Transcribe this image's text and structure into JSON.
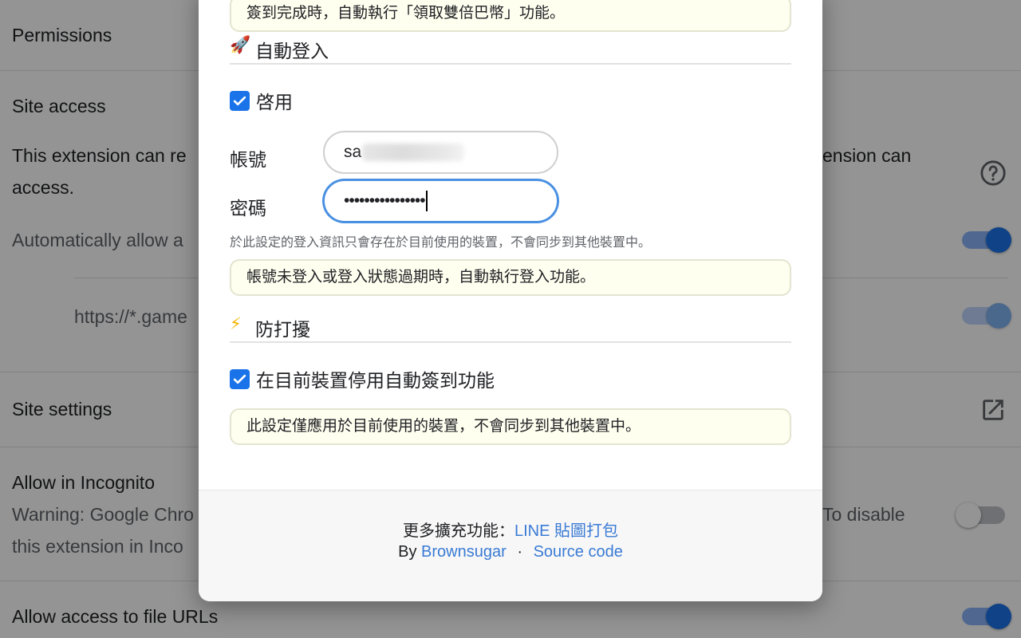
{
  "background": {
    "permissions_title": "Permissions",
    "site_access_title": "Site access",
    "site_access_desc_left": "This extension can re",
    "site_access_desc_right": "ension can",
    "site_access_desc_line2": "access.",
    "auto_allow_text": "Automatically allow a",
    "site_url": "https://*.game",
    "site_settings_title": "Site settings",
    "incognito_title": "Allow in Incognito",
    "incognito_warning_left": "Warning: Google Chro",
    "incognito_warning_right": "To disable",
    "incognito_warning_line2": "this extension in Inco",
    "file_urls_title": "Allow access to file URLs"
  },
  "dialog": {
    "top_note": "簽到完成時，自動執行「領取雙倍巴幣」功能。",
    "auto_login": {
      "emoji": "🚀",
      "title": "自動登入",
      "enable_label": "啓用",
      "enabled": true,
      "account_label": "帳號",
      "account_value": "sa",
      "password_label": "密碼",
      "password_value": "••••••••••••••••",
      "hint": "於此設定的登入資訊只會存在於目前使用的裝置，不會同步到其他裝置中。",
      "note": "帳號未登入或登入狀態過期時，自動執行登入功能。"
    },
    "anti_disturb": {
      "emoji": "⚡",
      "title": "防打擾",
      "disable_label": "在目前裝置停用自動簽到功能",
      "checked": true,
      "note": "此設定僅應用於目前使用的裝置，不會同步到其他裝置中。"
    },
    "footer": {
      "more_label": "更多擴充功能：",
      "more_link": "LINE 貼圖打包",
      "by_label": "By",
      "author_link": "Brownsugar",
      "separator": "·",
      "source_link": "Source code"
    }
  },
  "colors": {
    "accent": "#1a73e8",
    "link": "#3a7bd5",
    "note_bg": "#fffff0"
  }
}
